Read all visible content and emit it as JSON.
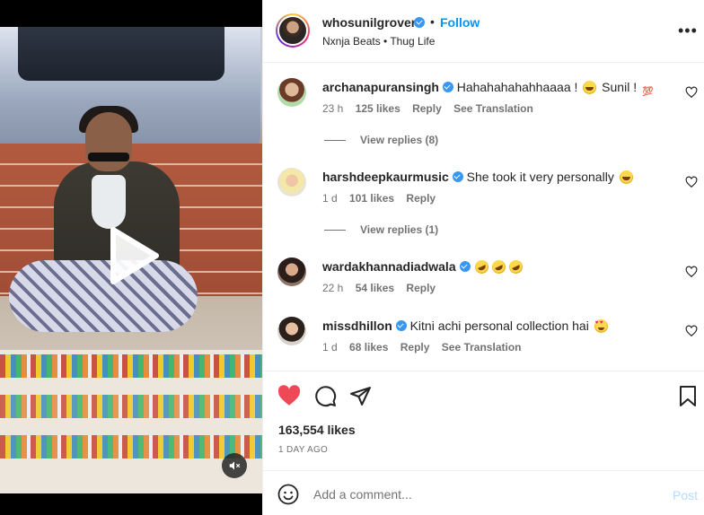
{
  "post": {
    "username": "whosunilgrover",
    "follow_label": "Follow",
    "separator": "•",
    "audio": "Nxnja Beats • Thug Life",
    "more_label": "•••"
  },
  "comments": [
    {
      "username": "archanapuransingh",
      "text": "Hahahahahahhaaaa ! ",
      "text_after": " Sunil ! ",
      "emojis": [
        "laughing-emoji",
        "hundred-emoji"
      ],
      "time": "23 h",
      "likes": "125 likes",
      "reply": "Reply",
      "translate": "See Translation",
      "view_replies": "View replies (8)"
    },
    {
      "username": "harshdeepkaurmusic",
      "text": "She took it very personally ",
      "emojis": [
        "laughing-emoji"
      ],
      "time": "1 d",
      "likes": "101 likes",
      "reply": "Reply",
      "view_replies": "View replies (1)"
    },
    {
      "username": "wardakhannadiadwala",
      "text": "",
      "emojis": [
        "rofl-emoji",
        "rofl-emoji",
        "rofl-emoji"
      ],
      "time": "22 h",
      "likes": "54 likes",
      "reply": "Reply"
    },
    {
      "username": "missdhillon",
      "text": "Kitni achi personal collection hai ",
      "emojis": [
        "heart-eyes-emoji"
      ],
      "time": "1 d",
      "likes": "68 likes",
      "reply": "Reply",
      "translate": "See Translation"
    }
  ],
  "actions": {
    "likes_count": "163,554 likes",
    "posted": "1 DAY AGO",
    "liked": true,
    "like_color": "#ed4956"
  },
  "add_comment": {
    "placeholder": "Add a comment...",
    "post_label": "Post"
  },
  "colors": {
    "accent": "#0095f6",
    "verified": "#3897f0",
    "muted": "#737373"
  }
}
